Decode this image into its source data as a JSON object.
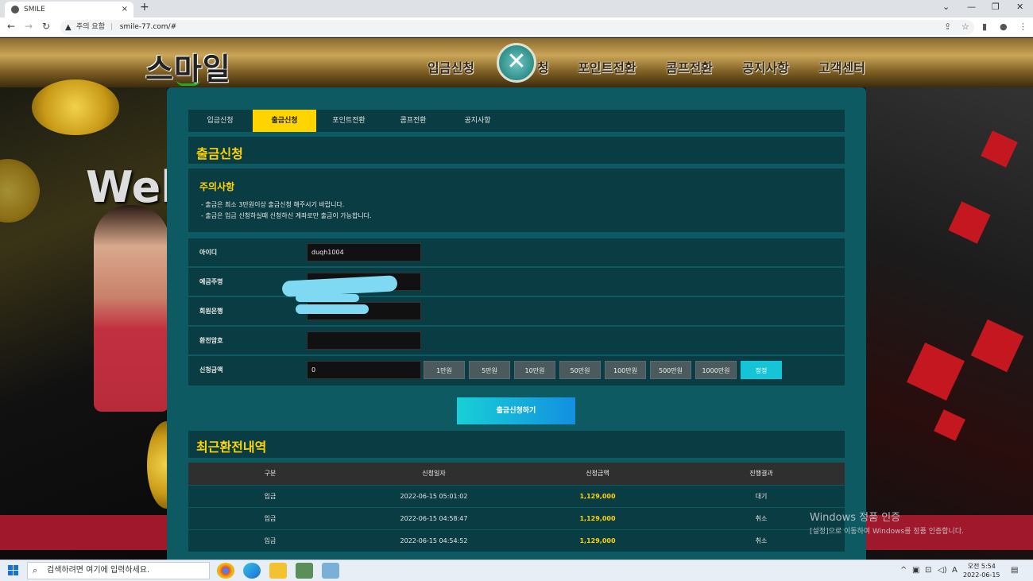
{
  "browser": {
    "tab_title": "SMILE",
    "tab_close": "×",
    "new_tab": "+",
    "security_label": "주의 요함",
    "url": "smile-77.com/#",
    "controls": [
      "⌄",
      "—",
      "❐",
      "✕"
    ]
  },
  "header": {
    "logo": "스마일",
    "nav": [
      "입금신청",
      "청",
      "포인트전환",
      "콤프전환",
      "공지사항",
      "고객센터"
    ]
  },
  "background": {
    "welcome": "Welc"
  },
  "subtabs": [
    {
      "label": "입금신청",
      "active": false
    },
    {
      "label": "출금신청",
      "active": true
    },
    {
      "label": "포인트전환",
      "active": false
    },
    {
      "label": "콤프전환",
      "active": false
    },
    {
      "label": "공지사항",
      "active": false
    }
  ],
  "page_title": "출금신청",
  "notice": {
    "title": "주의사항",
    "lines": [
      "- 출금은 최소 3만원이상 출금신청 해주시기 바랍니다.",
      "- 출금은 입금 신청하실때 신청하신 계좌로만 출금이 가능합니다."
    ]
  },
  "form": {
    "rows": [
      {
        "label": "아이디",
        "value": "duqh1004"
      },
      {
        "label": "예금주명",
        "value": ""
      },
      {
        "label": "회원은행",
        "value": ""
      },
      {
        "label": "환전암호",
        "value": ""
      },
      {
        "label": "신청금액",
        "value": "0"
      }
    ],
    "amount_buttons": [
      "1만원",
      "5만원",
      "10만원",
      "50만원",
      "100만원",
      "500만원",
      "1000만원"
    ],
    "reset_label": "정정",
    "submit_label": "출금신청하기"
  },
  "history": {
    "title": "최근환전내역",
    "columns": [
      "구분",
      "신청일자",
      "신청금액",
      "진행결과"
    ],
    "rows": [
      [
        "입금",
        "2022-06-15 05:01:02",
        "1,129,000",
        "대기"
      ],
      [
        "입금",
        "2022-06-15 04:58:47",
        "1,129,000",
        "취소"
      ],
      [
        "입금",
        "2022-06-15 04:54:52",
        "1,129,000",
        "취소"
      ]
    ]
  },
  "windows_activation": {
    "line1": "Windows 정품 인증",
    "line2": "[설정]으로 이동하여 Windows를 정품 인증합니다."
  },
  "taskbar": {
    "search_placeholder": "검색하려면 여기에 입력하세요.",
    "time": "오전 5:54",
    "date": "2022-06-15",
    "tray_icons": [
      "^",
      "▣",
      "⊡",
      "◁)",
      "A"
    ]
  },
  "colors": {
    "accent": "#ffd400",
    "panel": "#0e5a63",
    "row": "#0a3d43",
    "reset_button": "#16c4d8"
  }
}
